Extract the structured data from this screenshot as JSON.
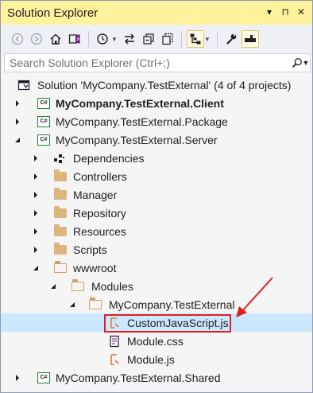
{
  "window": {
    "title": "Solution Explorer",
    "controls": [
      "▾",
      "⊓",
      "✕"
    ]
  },
  "search": {
    "placeholder": "Search Solution Explorer (Ctrl+;)"
  },
  "tree": {
    "solution": "Solution 'MyCompany.TestExternal' (4 of 4 projects)",
    "items": [
      {
        "label": "MyCompany.TestExternal.Client"
      },
      {
        "label": "MyCompany.TestExternal.Package"
      },
      {
        "label": "MyCompany.TestExternal.Server"
      },
      {
        "label": "Dependencies"
      },
      {
        "label": "Controllers"
      },
      {
        "label": "Manager"
      },
      {
        "label": "Repository"
      },
      {
        "label": "Resources"
      },
      {
        "label": "Scripts"
      },
      {
        "label": "wwwroot"
      },
      {
        "label": "Modules"
      },
      {
        "label": "MyCompany.TestExternal"
      },
      {
        "label": "CustomJavaScript.js"
      },
      {
        "label": "Module.css"
      },
      {
        "label": "Module.js"
      },
      {
        "label": "MyCompany.TestExternal.Shared"
      }
    ],
    "cs_badge": "C#"
  },
  "colors": {
    "title_bar": "#fff29d",
    "selected_row": "#cce8ff",
    "annotation": "#e02020"
  }
}
